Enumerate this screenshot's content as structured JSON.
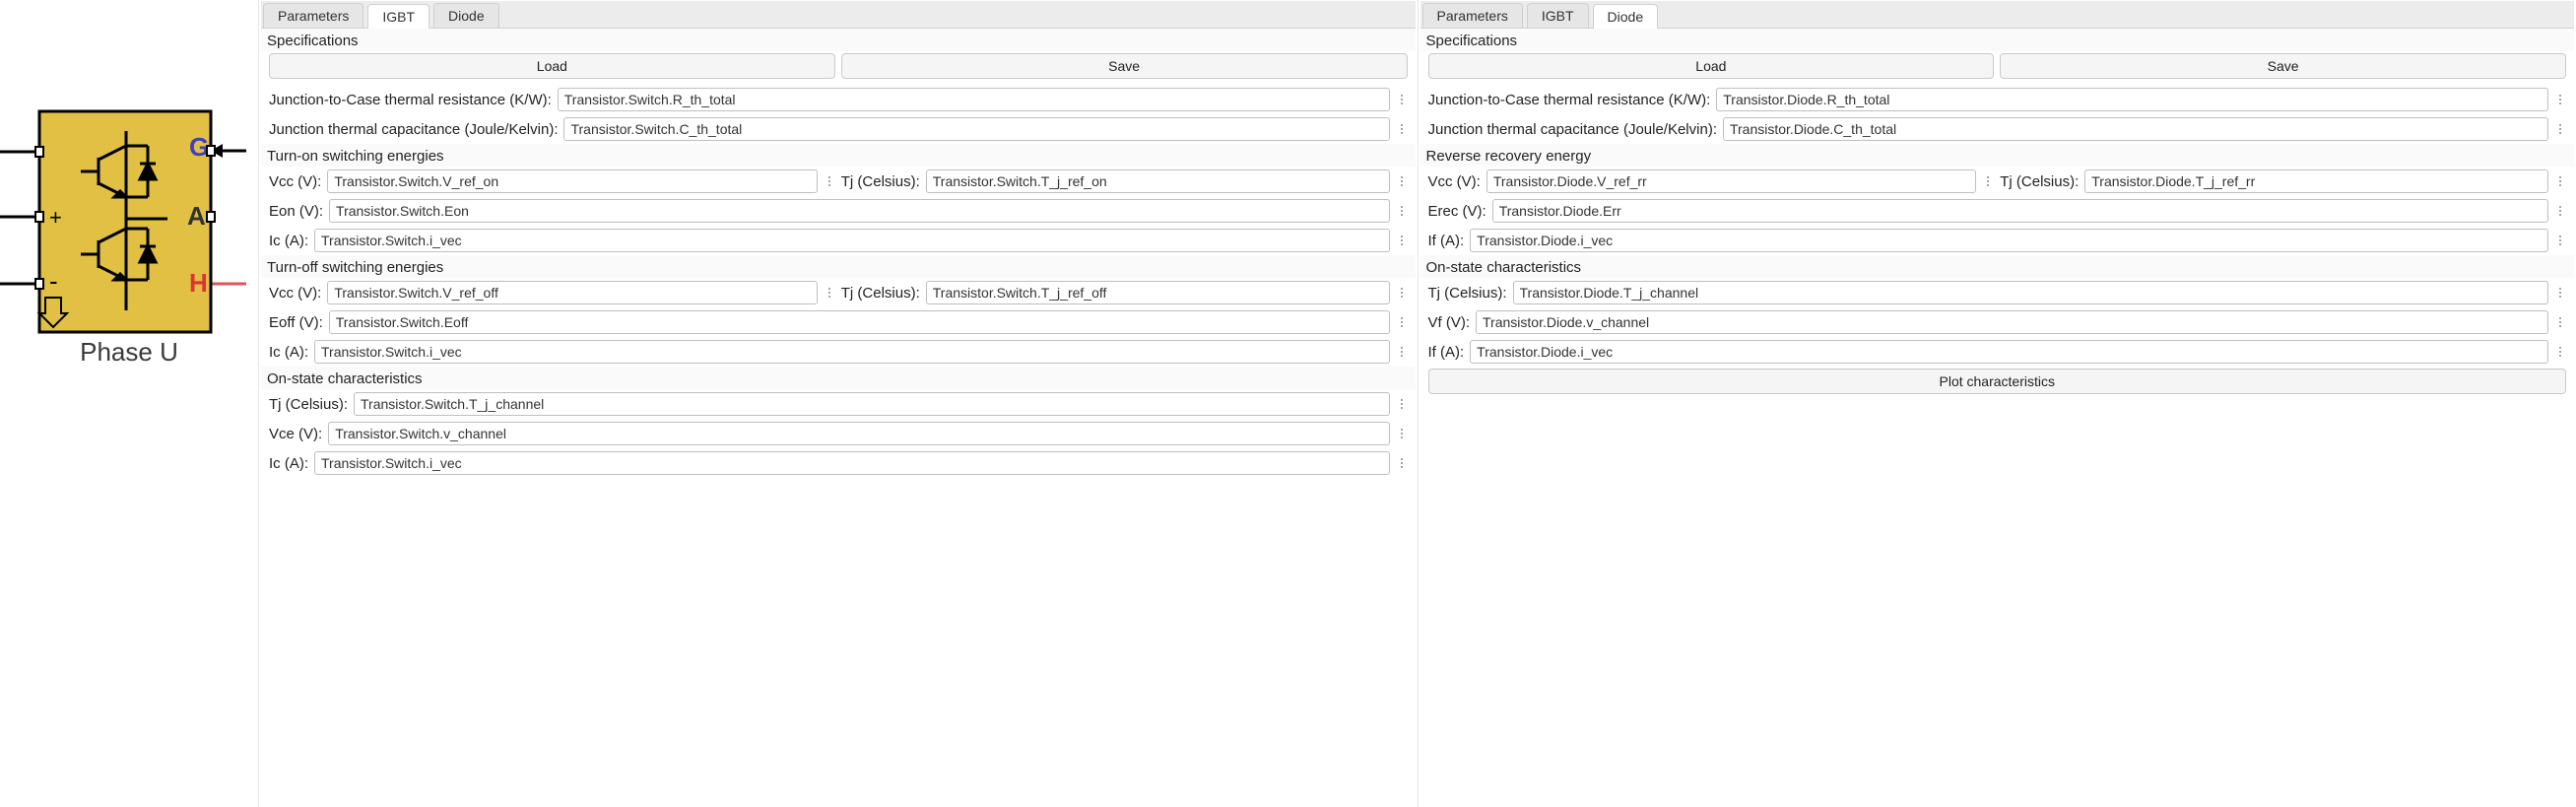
{
  "block": {
    "label": "Phase U"
  },
  "left": {
    "tabs": {
      "parameters": "Parameters",
      "igbt": "IGBT",
      "diode": "Diode"
    },
    "active_tab": "igbt",
    "sections": {
      "specs": "Specifications",
      "turn_on": "Turn-on switching energies",
      "turn_off": "Turn-off switching energies",
      "on_state": "On-state characteristics"
    },
    "buttons": {
      "load": "Load",
      "save": "Save"
    },
    "labels": {
      "r_th": "Junction-to-Case thermal resistance (K/W):",
      "c_th": "Junction thermal capacitance (Joule/Kelvin):",
      "vcc": "Vcc (V):",
      "tj": "Tj (Celsius):",
      "eon": "Eon (V):",
      "eoff": "Eoff (V):",
      "ic": "Ic (A):",
      "tj2": "Tj  (Celsius):",
      "vce": "Vce (V):"
    },
    "values": {
      "r_th": "Transistor.Switch.R_th_total",
      "c_th": "Transistor.Switch.C_th_total",
      "vcc_on": "Transistor.Switch.V_ref_on",
      "tj_on": "Transistor.Switch.T_j_ref_on",
      "eon": "Transistor.Switch.Eon",
      "ic_on": "Transistor.Switch.i_vec",
      "vcc_off": "Transistor.Switch.V_ref_off",
      "tj_off": "Transistor.Switch.T_j_ref_off",
      "eoff": "Transistor.Switch.Eoff",
      "ic_off": "Transistor.Switch.i_vec",
      "tj_ch": "Transistor.Switch.T_j_channel",
      "vce": "Transistor.Switch.v_channel",
      "ic_ch": "Transistor.Switch.i_vec"
    }
  },
  "right": {
    "tabs": {
      "parameters": "Parameters",
      "igbt": "IGBT",
      "diode": "Diode"
    },
    "active_tab": "diode",
    "sections": {
      "specs": "Specifications",
      "rr": "Reverse recovery energy",
      "on_state": "On-state characteristics"
    },
    "buttons": {
      "load": "Load",
      "save": "Save",
      "plot": "Plot characteristics"
    },
    "labels": {
      "r_th": "Junction-to-Case thermal resistance (K/W):",
      "c_th": "Junction thermal capacitance (Joule/Kelvin):",
      "vcc": "Vcc (V):",
      "tj2": "Tj  (Celsius):",
      "erec": "Erec (V):",
      "if": "If (A):",
      "tj": "Tj (Celsius):",
      "vf": "Vf (V):"
    },
    "values": {
      "r_th": "Transistor.Diode.R_th_total",
      "c_th": "Transistor.Diode.C_th_total",
      "vcc_rr": "Transistor.Diode.V_ref_rr",
      "tj_rr": "Transistor.Diode.T_j_ref_rr",
      "erec": "Transistor.Diode.Err",
      "if_rr": "Transistor.Diode.i_vec",
      "tj_ch": "Transistor.Diode.T_j_channel",
      "vf": "Transistor.Diode.v_channel",
      "if_ch": "Transistor.Diode.i_vec"
    }
  }
}
